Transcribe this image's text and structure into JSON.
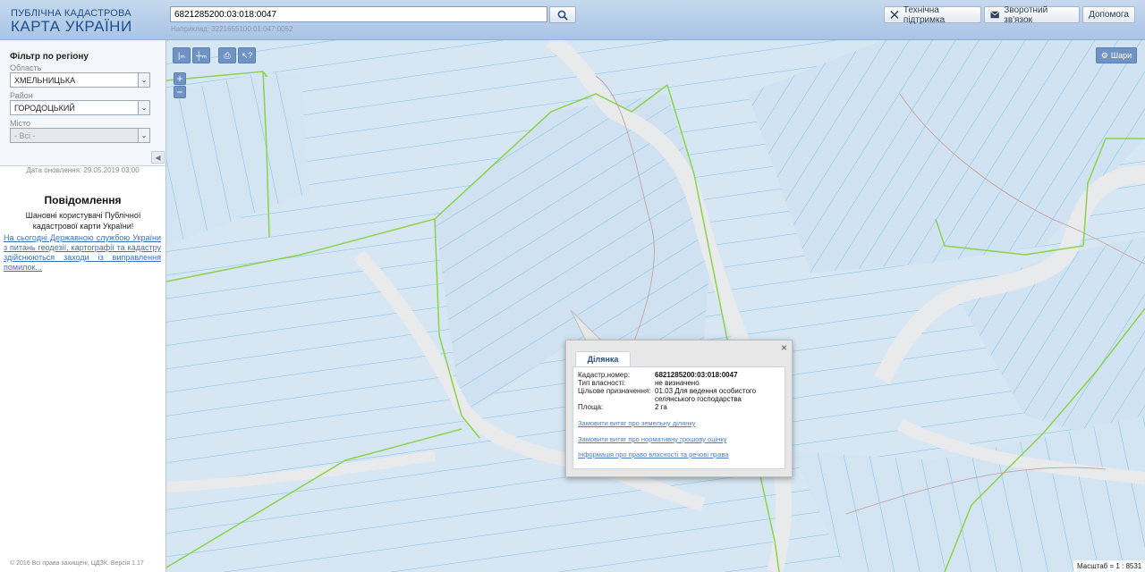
{
  "header": {
    "logo_top": "ПУБЛІЧНА КАДАСТРОВА",
    "logo_main": "КАРТА УКРАЇНИ",
    "search_value": "6821285200:03:018:0047",
    "search_hint": "Наприклад: 3221655100:01:047:0052",
    "buttons": {
      "support": "Технічна підтримка",
      "feedback": "Зворотний зв'язок",
      "help": "Допомога"
    }
  },
  "sidebar": {
    "filter_title": "Фільтр по регіону",
    "oblast_label": "Область",
    "oblast_value": "ХМЕЛЬНИЦЬКА",
    "rayon_label": "Район",
    "rayon_value": "ГОРОДОЦЬКИЙ",
    "misto_label": "Місто",
    "misto_value": "- Всі -",
    "update_date": "Дата оновлення: 29.05.2019 03:00",
    "notice_title": "Повідомлення",
    "notice_greeting": "Шановні користувачі Публічної кадастрової карти України!",
    "notice_link": "На сьогодні Державною службою України з питань геодезії, картографії та кадастру здійснюються заходи із виправлення помилок...",
    "copyright": "© 2016 Всі права захищені, ЦДЗК. Версія 1.17"
  },
  "map": {
    "layers_label": "Шари",
    "zoom_in": "+",
    "zoom_out": "−",
    "scale_text": "Масштаб = 1 : 8531"
  },
  "popup": {
    "tab": "Ділянка",
    "close": "×",
    "rows": {
      "cadastral_label": "Кадастр.номер:",
      "cadastral_value": "6821285200:03:018:0047",
      "ownership_label": "Тип власності:",
      "ownership_value": "не визначено",
      "purpose_label": "Цільове призначення:",
      "purpose_value": "01.03 Для ведення особистого селянського господарства",
      "area_label": "Площа:",
      "area_value": "2 га"
    },
    "links": {
      "extract_land": "Замовити витяг про земельну ділянку",
      "extract_valuation": "Замовити витяг про нормативну грошову оцінку",
      "rights_info": "Інформація про право власності та речові права"
    }
  }
}
